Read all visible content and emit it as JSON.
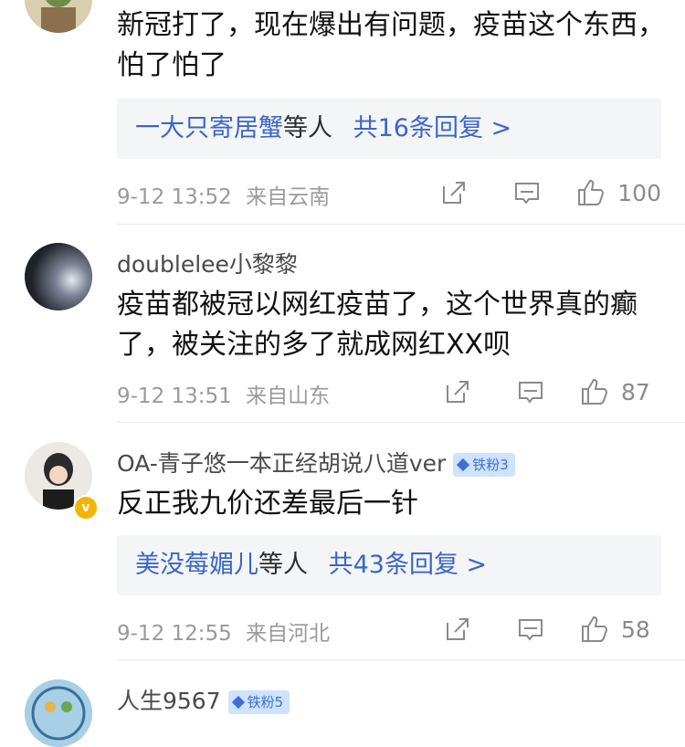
{
  "comments": [
    {
      "author": "",
      "text": "新冠打了，现在爆出有问题，疫苗这个东西，怕了怕了",
      "replies": {
        "users": "一大只寄居蟹",
        "suffix": "等人",
        "count_label": "共16条回复 >"
      },
      "time": "9-12 13:52",
      "location": "来自云南",
      "likes": "100"
    },
    {
      "author": "doublelee小黎黎",
      "text": "疫苗都被冠以网红疫苗了，这个世界真的癫了，被关注的多了就成网红XX呗",
      "time": "9-12 13:51",
      "location": "来自山东",
      "likes": "87"
    },
    {
      "author": "OA-青子悠一本正经胡说八道ver",
      "badge": "铁粉3",
      "verified_mark": "v",
      "text": "反正我九价还差最后一针",
      "replies": {
        "users": "美没莓媚儿",
        "suffix": "等人",
        "count_label": "共43条回复 >"
      },
      "time": "9-12 12:55",
      "location": "来自河北",
      "likes": "58"
    },
    {
      "author": "人生9567",
      "badge": "铁粉5"
    }
  ],
  "icons": {
    "share": "share-icon",
    "comment": "comment-icon",
    "like": "thumbs-up-icon"
  },
  "colors": {
    "link": "#3b66c8",
    "meta": "#9a9a9a",
    "badge_bg": "#cfe2ff",
    "badge_text": "#3e6fd9"
  }
}
